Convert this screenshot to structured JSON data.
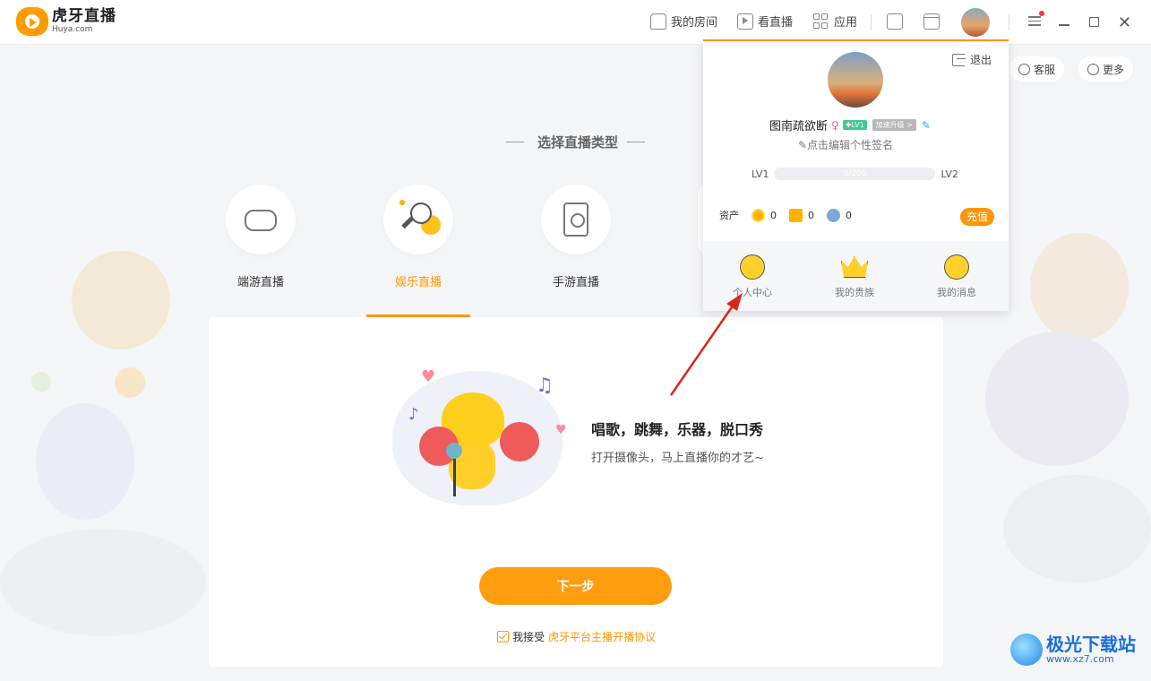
{
  "app": {
    "logo_cn": "虎牙直播",
    "logo_en": "Huya.com"
  },
  "topnav": {
    "my_room": "我的房间",
    "watch_live": "看直播",
    "apps": "应用"
  },
  "side_buttons": {
    "service": "客服",
    "more": "更多"
  },
  "section_title": "选择直播类型",
  "categories": [
    {
      "label": "端游直播",
      "icon": "gamepad-icon",
      "selected": false
    },
    {
      "label": "娱乐直播",
      "icon": "microphone-icon",
      "selected": true
    },
    {
      "label": "手游直播",
      "icon": "phone-icon",
      "selected": false
    }
  ],
  "entertainment": {
    "title": "唱歌，跳舞，乐器，脱口秀",
    "description": "打开摄像头，马上直播你的才艺~"
  },
  "next_button": "下一步",
  "agreement": {
    "prefix": "我接受",
    "link": "虎牙平台主播开播协议",
    "checked": true
  },
  "profile": {
    "logout": "退出",
    "username": "图南疏欲断",
    "gender_symbol": "♀",
    "level_badge": "✚LV1",
    "speed_badge": "加速升级 >",
    "edit_signature": "✎点击编辑个性签名",
    "level_current": "LV1",
    "level_next": "LV2",
    "level_progress": "0/200",
    "level_fraction": 0,
    "assets_label": "资产",
    "assets": [
      {
        "icon": "gold-coin-icon",
        "value": "0"
      },
      {
        "icon": "silver-bean-icon",
        "value": "0"
      },
      {
        "icon": "blue-gem-icon",
        "value": "0"
      }
    ],
    "recharge": "充值",
    "footer": {
      "personal_center": "个人中心",
      "my_noble": "我的贵族",
      "my_messages": "我的消息"
    }
  },
  "watermark": {
    "cn": "极光下载站",
    "url": "www.xz7.com"
  },
  "colors": {
    "accent": "#ff9600",
    "arrow": "#d9261c"
  }
}
